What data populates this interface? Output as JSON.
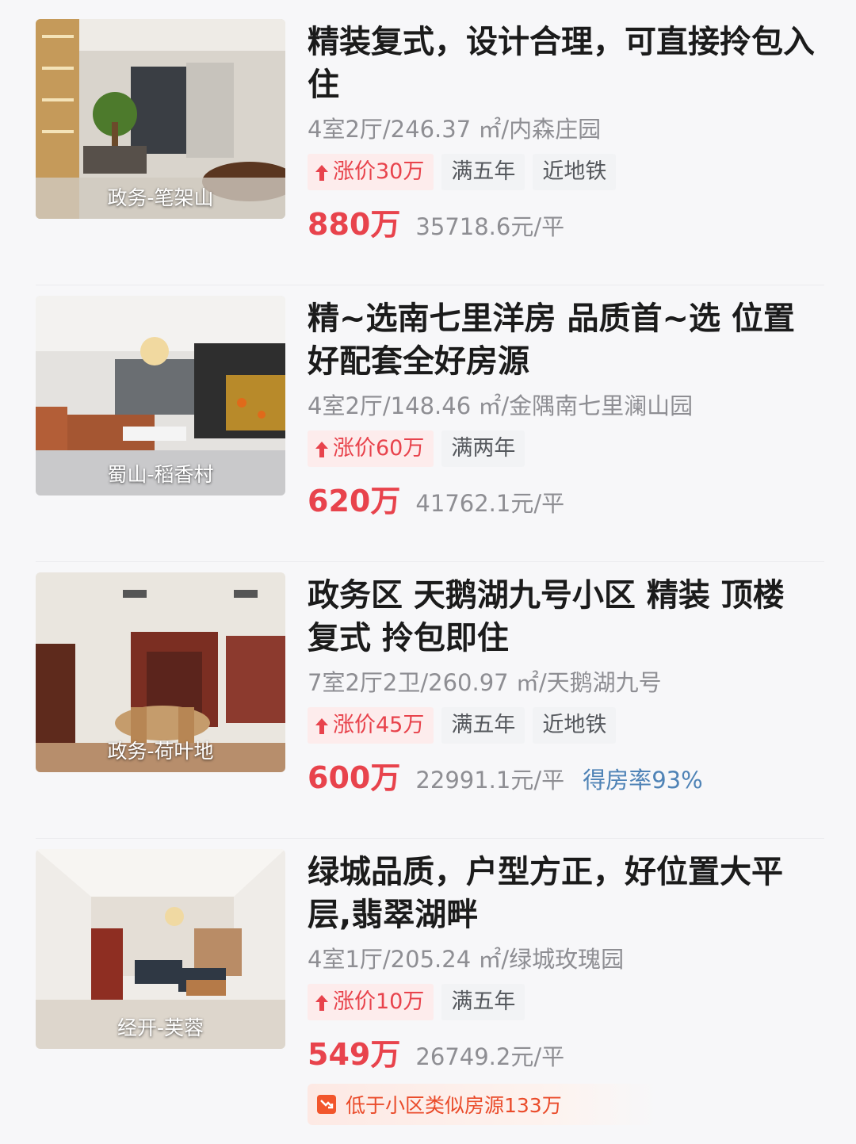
{
  "listings": [
    {
      "area": "政务-笔架山",
      "title": "精装复式，设计合理，可直接拎包入住",
      "meta": "4室2厅/246.37 ㎡/内森庄园",
      "price_change": "涨价30万",
      "tags": [
        "满五年",
        "近地铁"
      ],
      "price": "880万",
      "unit_price": "35718.6元/平",
      "rate": ""
    },
    {
      "area": "蜀山-稻香村",
      "title": "精~选南七里洋房 品质首~选 位置好配套全好房源",
      "meta": "4室2厅/148.46 ㎡/金隅南七里澜山园",
      "price_change": "涨价60万",
      "tags": [
        "满两年"
      ],
      "price": "620万",
      "unit_price": "41762.1元/平",
      "rate": ""
    },
    {
      "area": "政务-荷叶地",
      "title": "政务区 天鹅湖九号小区 精装 顶楼复式 拎包即住",
      "meta": "7室2厅2卫/260.97 ㎡/天鹅湖九号",
      "price_change": "涨价45万",
      "tags": [
        "满五年",
        "近地铁"
      ],
      "price": "600万",
      "unit_price": "22991.1元/平",
      "rate": "得房率93%"
    },
    {
      "area": "经开-芙蓉",
      "title": "绿城品质，户型方正，好位置大平层,翡翠湖畔",
      "meta": "4室1厅/205.24 ㎡/绿城玫瑰园",
      "price_change": "涨价10万",
      "tags": [
        "满五年"
      ],
      "price": "549万",
      "unit_price": "26749.2元/平",
      "rate": "",
      "promo": "低于小区类似房源133万"
    }
  ],
  "colors": {
    "price_red": "#e8434c",
    "rate_blue": "#4f83b6",
    "promo_orange": "#f2562c"
  },
  "icons": {
    "price_change": "arrow-up-icon",
    "promo": "trend-down-icon"
  }
}
